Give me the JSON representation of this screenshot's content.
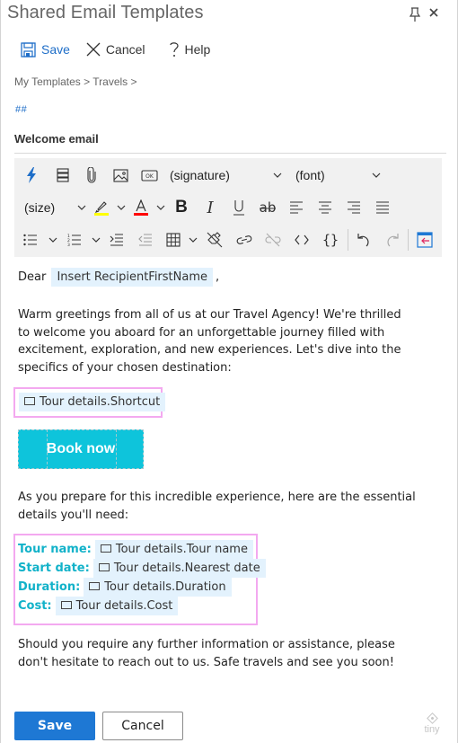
{
  "window": {
    "title": "Shared Email Templates",
    "pin_icon": "pin-icon",
    "close_icon": "close-icon"
  },
  "commands": {
    "save_label": "Save",
    "cancel_label": "Cancel",
    "help_label": "Help"
  },
  "breadcrumb": "My Templates > Travels >",
  "hashtags": "##",
  "template_name": "Welcome email",
  "toolbar": {
    "row1": [
      "macro-lightning",
      "paragraph-format",
      "attach",
      "image",
      "button-insert"
    ],
    "signature_select": "(signature)",
    "font_select": "(font)",
    "size_select": "(size)",
    "highlight_color": "#ffff00",
    "text_color": "#ff0000",
    "row2": [
      "highlight",
      "text-color",
      "bold",
      "italic",
      "underline",
      "strikethrough",
      "align-left",
      "align-center",
      "align-right",
      "justify"
    ],
    "row3": [
      "bullet-list",
      "numbered-list",
      "indent",
      "outdent",
      "table",
      "clear-format",
      "link",
      "unlink",
      "source-code",
      "braces",
      "undo",
      "redo",
      "exit"
    ]
  },
  "editor": {
    "greeting": "Dear",
    "recipient_placeholder": "Insert RecipientFirstName",
    "greeting_suffix": ",",
    "intro": "Warm greetings from all of us at our Travel Agency! We're thrilled to welcome you aboard for an unforgettable journey filled with excitement, exploration, and new experiences. Let's dive into the specifics of your chosen destination:",
    "shortcut_placeholder": "Tour details.Shortcut",
    "book_button": "Book now",
    "prep_text": "As you prepare for this incredible experience, here are the essential details you'll need:",
    "details": [
      {
        "label": "Tour name:",
        "value": "Tour details.Tour name"
      },
      {
        "label": "Start date:",
        "value": "Tour details.Nearest date"
      },
      {
        "label": "Duration:",
        "value": "Tour details.Duration"
      },
      {
        "label": "Cost:",
        "value": "Tour details.Cost"
      }
    ],
    "closing": "Should you require any further information or assistance, please don't hesitate to reach out to us. Safe travels and see you soon!"
  },
  "footer": {
    "save_label": "Save",
    "cancel_label": "Cancel",
    "branding": "tiny"
  },
  "colors": {
    "accent": "#1e78d4",
    "label_teal": "#12b2c9",
    "book_button": "#0ec4db",
    "placeholder_bg": "#e3f2fd",
    "highlight_border": "#f3a9f0"
  }
}
